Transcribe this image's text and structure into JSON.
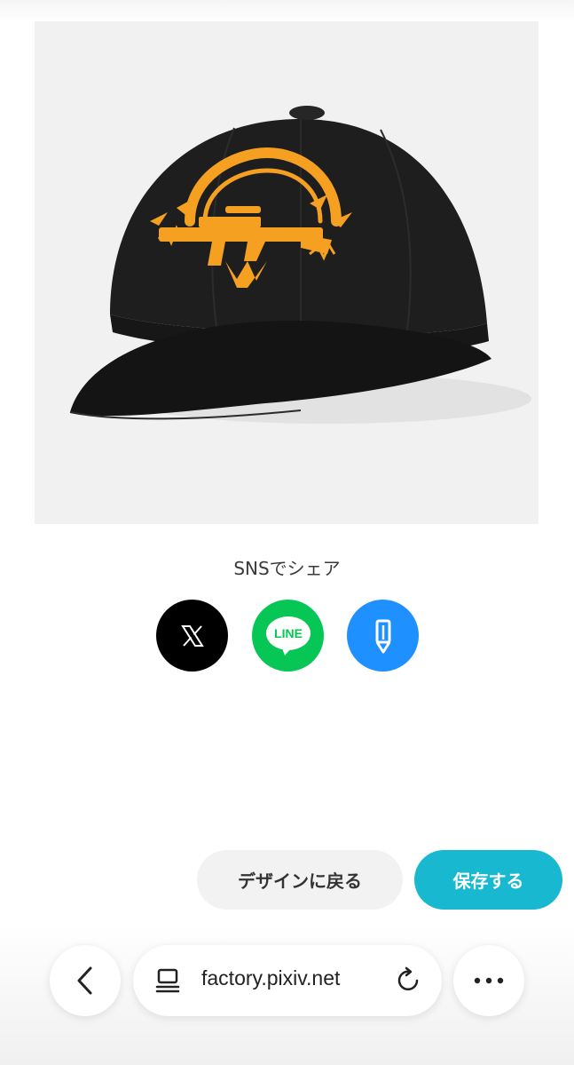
{
  "product": {
    "image_alt": "black cap with orange rifle emblem"
  },
  "share": {
    "title": "SNSでシェア",
    "buttons": [
      {
        "name": "x",
        "icon": "x-logo-icon",
        "color": "#000000"
      },
      {
        "name": "line",
        "icon": "line-logo-icon",
        "label": "LINE",
        "color": "#06c755"
      },
      {
        "name": "blog",
        "icon": "pencil-icon",
        "color": "#1e90ff"
      }
    ]
  },
  "actions": {
    "back_to_design": "デザインに戻る",
    "save": "保存する",
    "save_color": "#17b8d0"
  },
  "browser": {
    "url": "factory.pixiv.net",
    "back_icon": "chevron-left-icon",
    "tab_icon": "tabs-icon",
    "reload_icon": "reload-icon",
    "more_icon": "more-horizontal-icon"
  }
}
